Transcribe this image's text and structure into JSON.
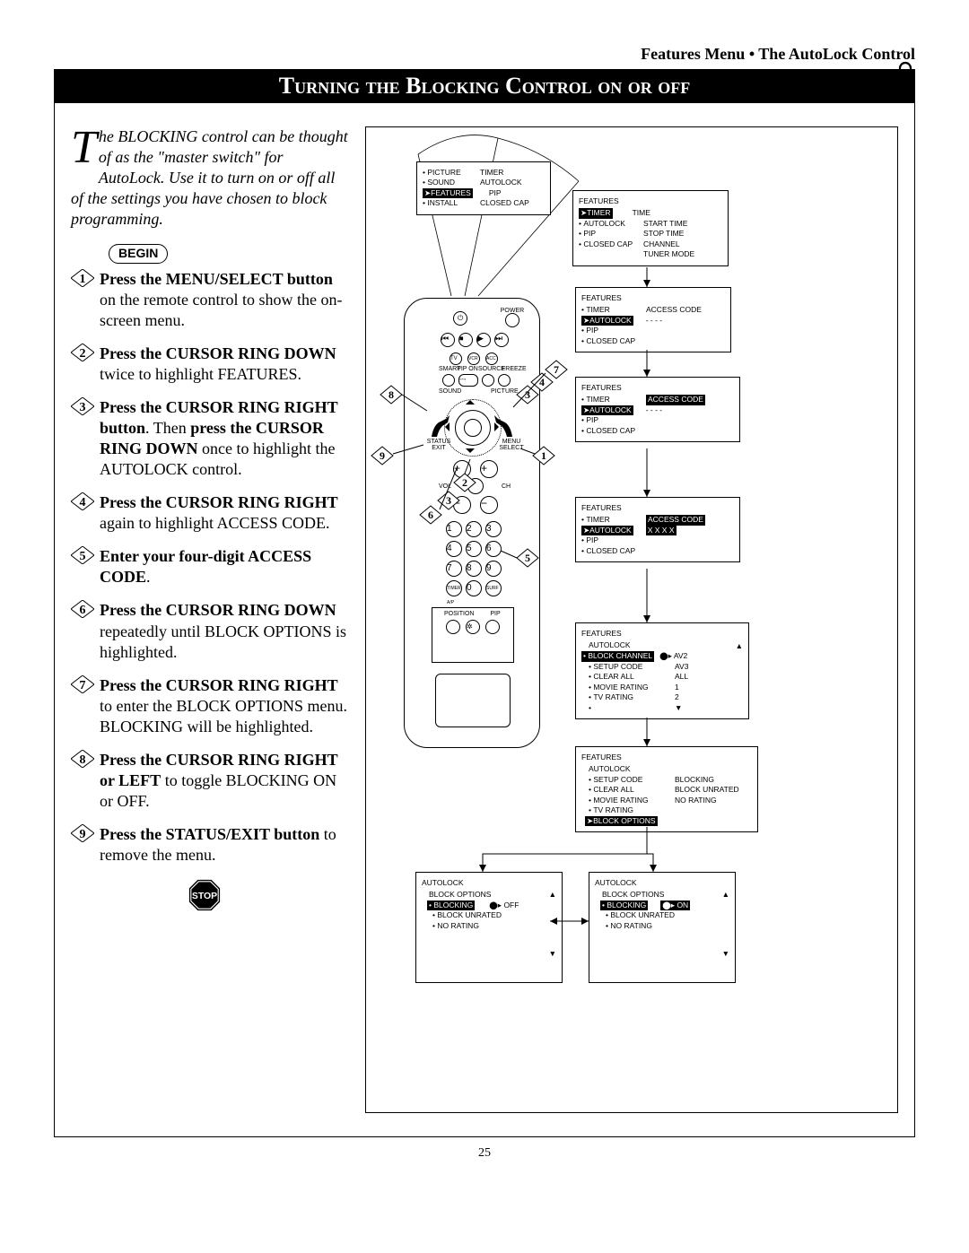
{
  "header": "Features Menu • The AutoLock Control",
  "title": "Turning the Blocking Control on or off",
  "intro": {
    "dropcap": "T",
    "rest": "he BLOCKING control can be thought of as the \"master switch\" for AutoLock. Use it to turn on or off all of the settings you have chosen to block programming."
  },
  "begin_label": "BEGIN",
  "steps": [
    {
      "n": "1",
      "bold": "Press the MENU/SELECT button",
      "rest": " on the remote control to show the on-screen menu."
    },
    {
      "n": "2",
      "bold": "Press the CURSOR RING DOWN",
      "rest": " twice to highlight FEATURES."
    },
    {
      "n": "3",
      "bold": "Press the CURSOR RING RIGHT button",
      "rest": ". Then ",
      "bold2": "press the CURSOR RING DOWN",
      "rest2": " once to highlight the AUTOLOCK control."
    },
    {
      "n": "4",
      "bold": "Press the CURSOR RING RIGHT",
      "rest": " again to highlight ACCESS CODE."
    },
    {
      "n": "5",
      "bold": "Enter your four-digit ACCESS CODE",
      "rest": "."
    },
    {
      "n": "6",
      "bold": "Press the CURSOR RING DOWN",
      "rest": " repeatedly until BLOCK OPTIONS is highlighted."
    },
    {
      "n": "7",
      "bold": "Press the CURSOR RING RIGHT",
      "rest": " to enter the BLOCK OPTIONS menu. BLOCKING will be highlighted."
    },
    {
      "n": "8",
      "bold": "Press the CURSOR RING RIGHT or LEFT",
      "rest": " to toggle BLOCKING ON or OFF."
    },
    {
      "n": "9",
      "bold": "Press the STATUS/EXIT button",
      "rest": " to remove the menu."
    }
  ],
  "stop_label": "STOP",
  "page_number": "25",
  "menus": {
    "m1": {
      "col1": [
        "PICTURE",
        "SOUND",
        "FEATURES",
        "INSTALL"
      ],
      "col2": [
        "TIMER",
        "AUTOLOCK",
        "PIP",
        "CLOSED CAP"
      ],
      "hl": "FEATURES",
      "pointer": true
    },
    "m2": {
      "title": "FEATURES",
      "col1": [
        "TIMER",
        "AUTOLOCK",
        "PIP",
        "CLOSED CAP"
      ],
      "col2": [
        "TIME",
        "START TIME",
        "STOP TIME",
        "CHANNEL",
        "TUNER MODE"
      ],
      "hl": "TIMER",
      "pointer": true
    },
    "m3": {
      "title": "FEATURES",
      "col1": [
        "TIMER",
        "AUTOLOCK",
        "PIP",
        "CLOSED CAP"
      ],
      "col2": [
        "ACCESS CODE",
        "- - - -"
      ],
      "hl": "AUTOLOCK",
      "pointer": true
    },
    "m4": {
      "title": "FEATURES",
      "col1": [
        "TIMER",
        "AUTOLOCK",
        "PIP",
        "CLOSED CAP"
      ],
      "col2": [
        "ACCESS CODE",
        "- - - -"
      ],
      "hl": "AUTOLOCK",
      "hl2": "ACCESS CODE",
      "pointer": true
    },
    "m5": {
      "title": "FEATURES",
      "col1": [
        "TIMER",
        "AUTOLOCK",
        "PIP",
        "CLOSED CAP"
      ],
      "col2": [
        "ACCESS CODE",
        "X X X X"
      ],
      "hl": "AUTOLOCK",
      "hl2": "ACCESS CODE",
      "pointer": true
    },
    "m6": {
      "title": "FEATURES",
      "subtitle": "AUTOLOCK",
      "col1": [
        "BLOCK CHANNEL",
        "SETUP CODE",
        "CLEAR ALL",
        "MOVIE RATING",
        "TV RATING",
        ""
      ],
      "col2": [
        "AV2",
        "AV3",
        "ALL",
        "1",
        "2",
        "⬇"
      ],
      "hl": "BLOCK CHANNEL",
      "pointer": true
    },
    "m7": {
      "title": "FEATURES",
      "subtitle": "AUTOLOCK",
      "col1": [
        "SETUP CODE",
        "CLEAR ALL",
        "MOVIE RATING",
        "TV RATING",
        "BLOCK OPTIONS"
      ],
      "col2": [
        "BLOCKING",
        "BLOCK UNRATED",
        "NO RATING"
      ],
      "hl": "BLOCK OPTIONS",
      "pointer": true
    },
    "m8a": {
      "title": "AUTOLOCK",
      "subtitle": "BLOCK OPTIONS",
      "col1": [
        "BLOCKING",
        "BLOCK UNRATED",
        "NO RATING"
      ],
      "col2": [
        "OFF"
      ],
      "hl": "BLOCKING",
      "hl2": "OFF"
    },
    "m8b": {
      "title": "AUTOLOCK",
      "subtitle": "BLOCK OPTIONS",
      "col1": [
        "BLOCKING",
        "BLOCK UNRATED",
        "NO RATING"
      ],
      "col2": [
        "ON"
      ],
      "hl": "BLOCKING",
      "hl2": "ON"
    }
  },
  "remote_labels": {
    "power": "POWER",
    "tv": "TV",
    "vcr": "VCR",
    "acc": "ACC",
    "smart": "SMART",
    "pipon": "PIP ON",
    "source": "SOURCE",
    "freeze": "FREEZE",
    "sound": "SOUND",
    "picture": "PICTURE",
    "status_exit": "STATUS EXIT",
    "menu_select": "MENU SELECT",
    "vol": "VOL",
    "ch": "CH",
    "timer_ap": "TIMER A/P",
    "surf": "SURF",
    "position": "POSITION",
    "pip": "PIP"
  },
  "callouts": [
    "1",
    "2",
    "3",
    "4",
    "5",
    "6",
    "7",
    "8",
    "9"
  ]
}
